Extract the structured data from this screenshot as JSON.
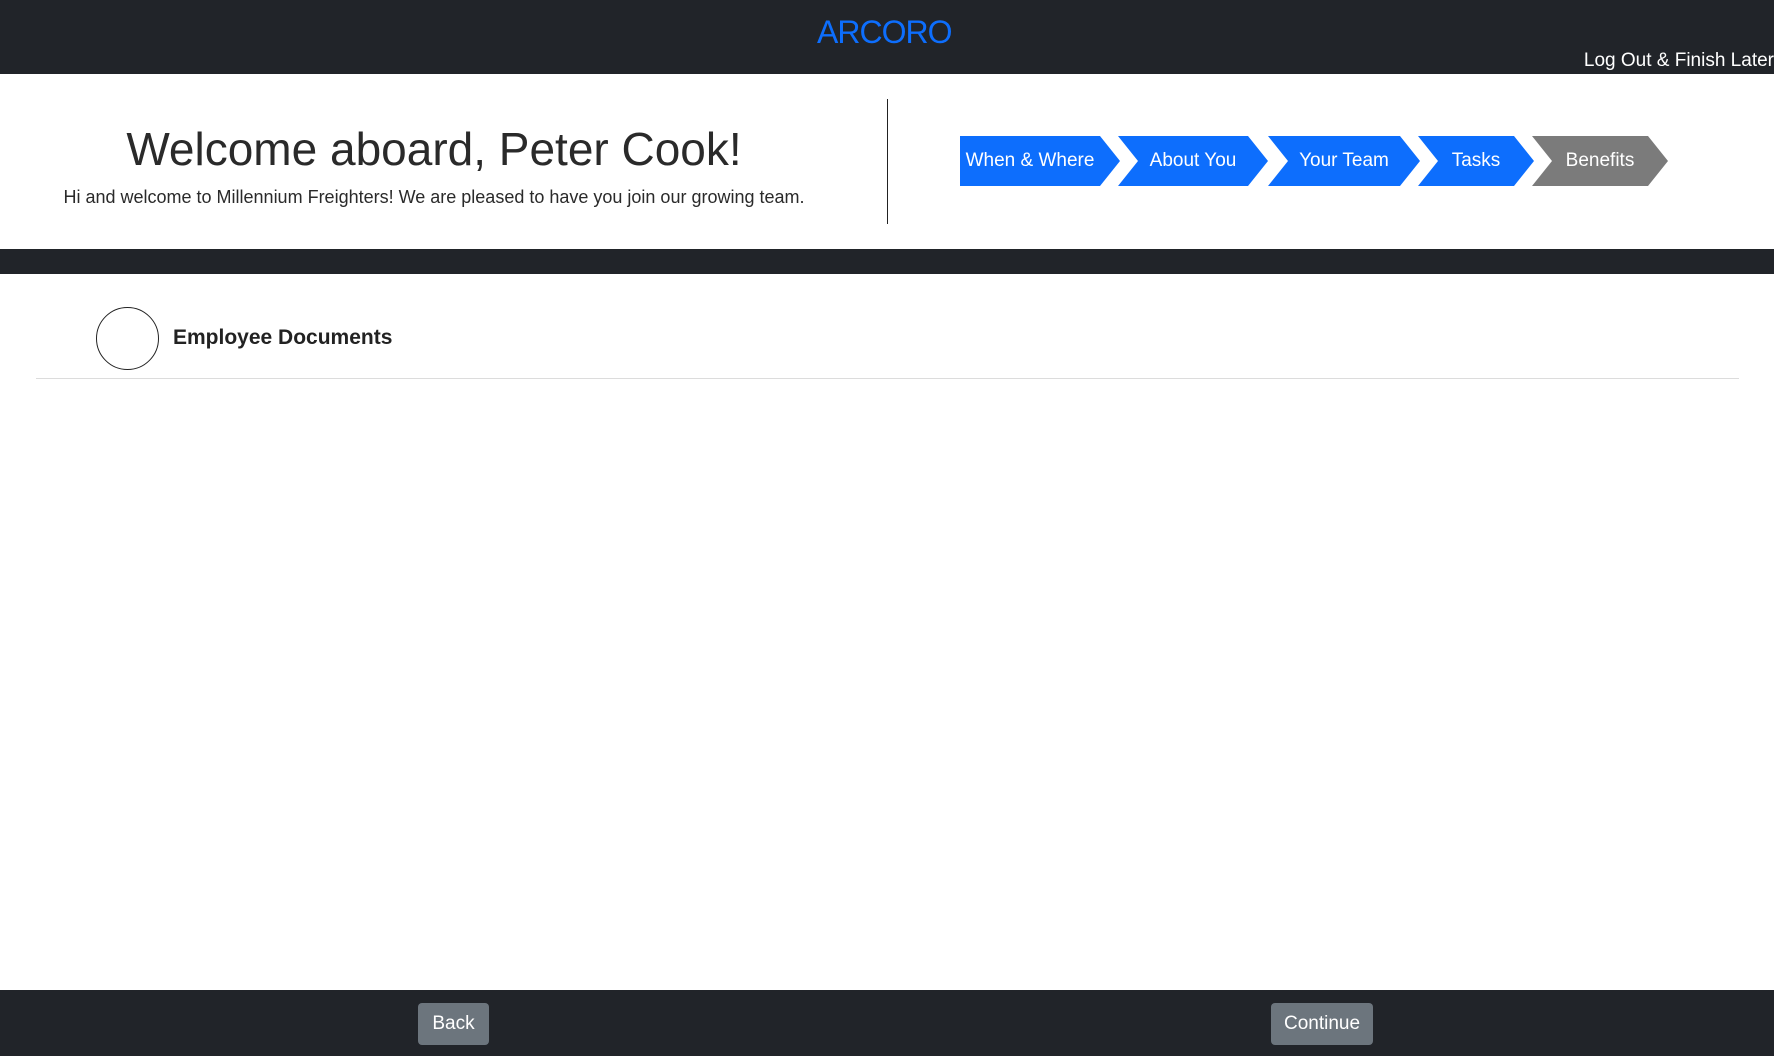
{
  "header": {
    "logo_text": "ARCORO",
    "logout_label": "Log Out & Finish Later"
  },
  "welcome": {
    "title": "Welcome aboard, Peter Cook!",
    "subtitle": "Hi and welcome to Millennium Freighters! We are pleased to have you join our growing team."
  },
  "steps": [
    {
      "label": "When & Where",
      "state": "active"
    },
    {
      "label": "About You",
      "state": "active"
    },
    {
      "label": "Your Team",
      "state": "active"
    },
    {
      "label": "Tasks",
      "state": "active"
    },
    {
      "label": "Benefits",
      "state": "inactive"
    }
  ],
  "section": {
    "title": "Employee Documents"
  },
  "footer": {
    "back_label": "Back",
    "continue_label": "Continue"
  },
  "colors": {
    "accent": "#0d6efd",
    "inactive_step": "#7b7b7b",
    "dark_bar": "#212429",
    "button": "#6c757d"
  }
}
